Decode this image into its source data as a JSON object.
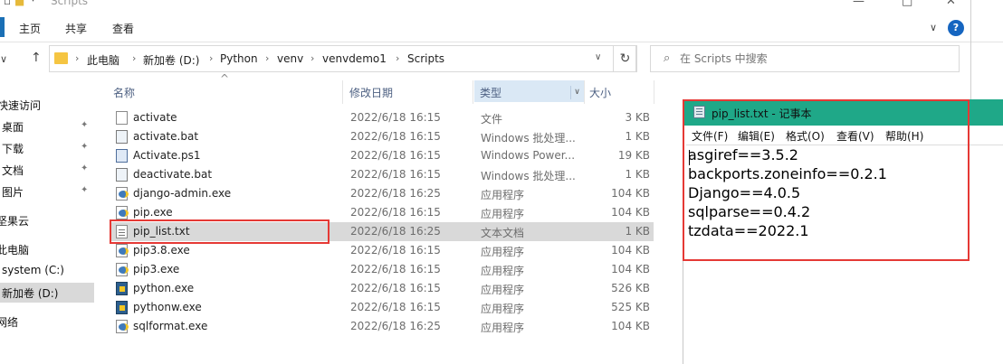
{
  "window": {
    "title": "Scripts"
  },
  "ribbon": {
    "tabs": [
      "主页",
      "共享",
      "查看"
    ]
  },
  "address": {
    "crumbs": [
      "此电脑",
      "新加卷 (D:)",
      "Python",
      "venv",
      "venvdemo1",
      "Scripts"
    ]
  },
  "search": {
    "placeholder": "在 Scripts 中搜索"
  },
  "nav": {
    "items": [
      {
        "label": "快速访问",
        "pinned": false
      },
      {
        "label": "桌面",
        "pinned": true
      },
      {
        "label": "下载",
        "pinned": true
      },
      {
        "label": "文档",
        "pinned": true
      },
      {
        "label": "图片",
        "pinned": true
      },
      {
        "label": "坚果云",
        "pinned": false
      },
      {
        "label": "此电脑",
        "pinned": false
      },
      {
        "label": "system (C:)",
        "pinned": false
      },
      {
        "label": "新加卷 (D:)",
        "pinned": false,
        "selected": true
      },
      {
        "label": "网络",
        "pinned": false
      }
    ]
  },
  "columns": {
    "name": "名称",
    "date": "修改日期",
    "type": "类型",
    "size": "大小"
  },
  "files": [
    {
      "name": "activate",
      "date": "2022/6/18 16:15",
      "type": "文件",
      "size": "3 KB",
      "icon": "doc-icon"
    },
    {
      "name": "activate.bat",
      "date": "2022/6/18 16:15",
      "type": "Windows 批处理...",
      "size": "1 KB",
      "icon": "bat-icon"
    },
    {
      "name": "Activate.ps1",
      "date": "2022/6/18 16:15",
      "type": "Windows Power...",
      "size": "19 KB",
      "icon": "ps1-icon"
    },
    {
      "name": "deactivate.bat",
      "date": "2022/6/18 16:15",
      "type": "Windows 批处理...",
      "size": "1 KB",
      "icon": "bat-icon"
    },
    {
      "name": "django-admin.exe",
      "date": "2022/6/18 16:25",
      "type": "应用程序",
      "size": "104 KB",
      "icon": "exe-icon"
    },
    {
      "name": "pip.exe",
      "date": "2022/6/18 16:15",
      "type": "应用程序",
      "size": "104 KB",
      "icon": "exe-icon"
    },
    {
      "name": "pip_list.txt",
      "date": "2022/6/18 16:25",
      "type": "文本文档",
      "size": "1 KB",
      "icon": "txt-icon",
      "selected": true
    },
    {
      "name": "pip3.8.exe",
      "date": "2022/6/18 16:15",
      "type": "应用程序",
      "size": "104 KB",
      "icon": "exe-icon"
    },
    {
      "name": "pip3.exe",
      "date": "2022/6/18 16:15",
      "type": "应用程序",
      "size": "104 KB",
      "icon": "exe-icon"
    },
    {
      "name": "python.exe",
      "date": "2022/6/18 16:15",
      "type": "应用程序",
      "size": "526 KB",
      "icon": "python-exe-icon"
    },
    {
      "name": "pythonw.exe",
      "date": "2022/6/18 16:15",
      "type": "应用程序",
      "size": "525 KB",
      "icon": "python-exe-icon"
    },
    {
      "name": "sqlformat.exe",
      "date": "2022/6/18 16:25",
      "type": "应用程序",
      "size": "104 KB",
      "icon": "exe-icon"
    }
  ],
  "notepad": {
    "title": "pip_list.txt - 记事本",
    "menu": [
      "文件(F)",
      "编辑(E)",
      "格式(O)",
      "查看(V)",
      "帮助(H)"
    ],
    "lines": [
      "asgiref==3.5.2",
      "backports.zoneinfo==0.2.1",
      "Django==4.0.5",
      "sqlparse==0.4.2",
      "tzdata==2022.1"
    ]
  },
  "colors": {
    "notepad_titlebar": "#1fa888",
    "highlight_red": "#e53935",
    "header_type_bg": "#dae8f5"
  }
}
